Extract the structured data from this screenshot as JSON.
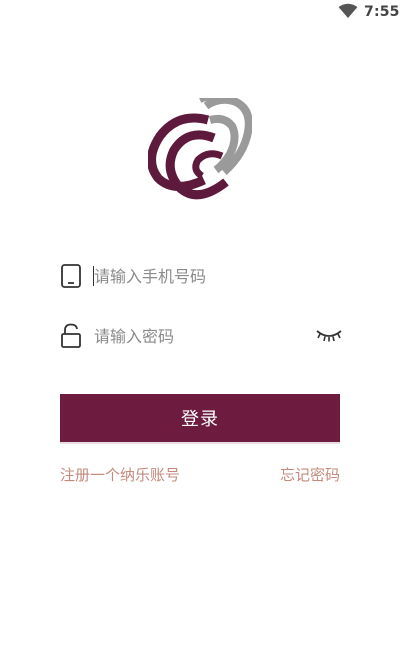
{
  "status_bar": {
    "time": "7:55",
    "wifi_icon": "wifi-icon"
  },
  "logo": {
    "icon": "interlocking-rings-logo",
    "colors": {
      "primary": "#5e1a3c",
      "secondary": "#9a9a9a"
    }
  },
  "login_form": {
    "phone": {
      "icon": "phone-icon",
      "placeholder": "请输入手机号码",
      "value": ""
    },
    "password": {
      "icon": "unlock-icon",
      "placeholder": "请输入密码",
      "value": "",
      "visibility_icon": "eye-closed-icon"
    },
    "submit_label": "登录",
    "register_link": "注册一个纳乐账号",
    "forgot_link": "忘记密码"
  },
  "colors": {
    "brand": "#6d1c40",
    "link": "#c58a7c",
    "background": "#ffffff"
  }
}
